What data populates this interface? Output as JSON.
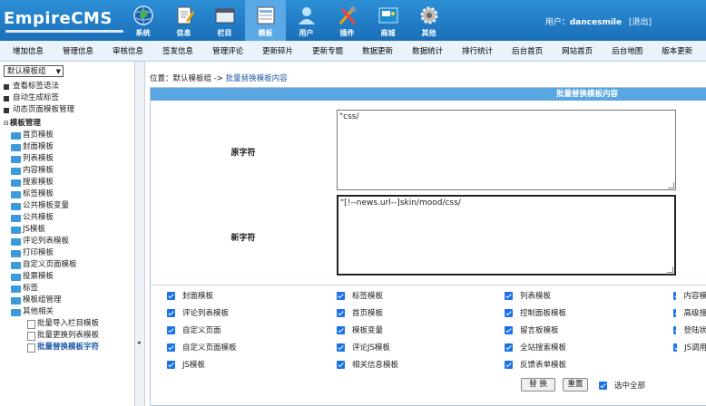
{
  "app": {
    "logo": "EmpireCMS",
    "user_text": "用户：",
    "user_name": "dancesmile",
    "logout": "[退出]"
  },
  "nav": [
    {
      "label": "系统",
      "icon": "globe-icon"
    },
    {
      "label": "信息",
      "icon": "notepad-icon"
    },
    {
      "label": "栏目",
      "icon": "folder-icon"
    },
    {
      "label": "模板",
      "icon": "template-icon",
      "active": true
    },
    {
      "label": "用户",
      "icon": "user-icon"
    },
    {
      "label": "插件",
      "icon": "tools-icon"
    },
    {
      "label": "商城",
      "icon": "shop-icon"
    },
    {
      "label": "其他",
      "icon": "gear-icon"
    }
  ],
  "subnav": [
    "增加信息",
    "管理信息",
    "审核信息",
    "签发信息",
    "管理评论",
    "更新碎片",
    "更新专题",
    "数据更新",
    "数据统计",
    "排行统计",
    "后台首页",
    "网站首页",
    "后台地图",
    "版本更新"
  ],
  "sidebar": {
    "select": "默认模板组",
    "top_items": [
      "查看标签语法",
      "自动生成标签",
      "动态页面模板管理"
    ],
    "group_title": "模板管理",
    "items": [
      "首页模板",
      "封面模板",
      "列表模板",
      "内容模板",
      "搜索模板",
      "标签模板",
      "公共模板变量",
      "公共模板",
      "JS模板",
      "评论列表模板",
      "打印模板",
      "自定义页面模板",
      "投票模板",
      "标签",
      "模板组管理",
      "其他相关"
    ],
    "sub_items": [
      "批量导入栏目模板",
      "批量更换列表模板",
      "批量替换模板字符"
    ]
  },
  "breadcrumb": {
    "prefix": "位置：默认模板组 ->",
    "current": "批量替换模板内容"
  },
  "form": {
    "title": "批量替换模板内容",
    "old_label": "原字符",
    "old_value": "\"css/",
    "new_label": "新字符",
    "new_value": "\"[!--news.url--]skin/mood/css/",
    "checkboxes": [
      [
        "封面模板",
        "标签模板",
        "列表模板",
        "内容模"
      ],
      [
        "评论列表模板",
        "首页模板",
        "控制面板模板",
        "高级搜"
      ],
      [
        "自定义页面",
        "模板变量",
        "留言板模板",
        "登陆状"
      ],
      [
        "自定义页面模板",
        "评论JS模板",
        "全站搜索模板",
        "JS调用"
      ],
      [
        "JS模板",
        "相关信息模板",
        "反馈表单模板"
      ]
    ],
    "replace_btn": "替 换",
    "reset_btn": "重置",
    "select_all": "选中全部"
  },
  "colors": {
    "header": "#1f7cc6",
    "panel_head": "#5aa6e0",
    "accent": "#1a73e8"
  }
}
